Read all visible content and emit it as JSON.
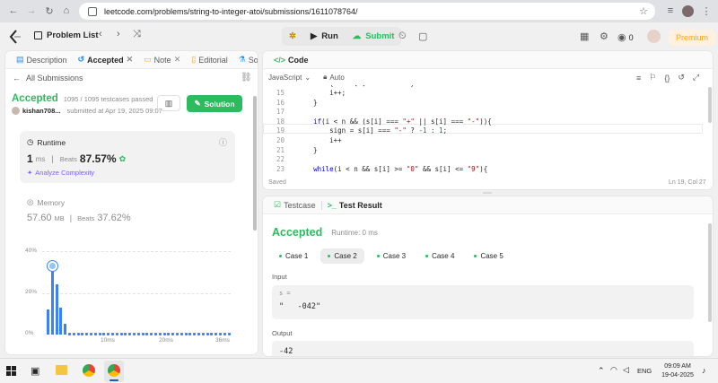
{
  "browser": {
    "url": "leetcode.com/problems/string-to-integer-atoi/submissions/1611078764/"
  },
  "nav": {
    "problem_list": "Problem List",
    "run": "Run",
    "submit": "Submit",
    "coins": "0",
    "premium": "Premium"
  },
  "left": {
    "tabs": [
      "Description",
      "Accepted",
      "Note",
      "Editorial",
      "Soluti"
    ],
    "all_submissions": "All Submissions",
    "status": "Accepted",
    "testcases": "1095 / 1095 testcases passed",
    "user": "kishan708...",
    "submitted": "submitted at Apr 19, 2025 09:07",
    "solution_btn": "Solution",
    "runtime_label": "Runtime",
    "runtime_value": "1",
    "runtime_unit": "ms",
    "beats_label": "Beats",
    "runtime_beats": "87.57%",
    "analyze": "Analyze Complexity",
    "memory_label": "Memory",
    "memory_value": "57.60",
    "memory_unit": "MB",
    "memory_beats": "37.62%"
  },
  "chart_data": {
    "type": "bar",
    "y_ticks": [
      "40%",
      "20%",
      "0%"
    ],
    "x_ticks": [
      "10ms",
      "20ms",
      "36ms"
    ],
    "ylim": [
      0,
      40
    ],
    "values": [
      12,
      34,
      24,
      13,
      5,
      1,
      1,
      1,
      1,
      1,
      1,
      1,
      1,
      1,
      1,
      1,
      1,
      1,
      1,
      1,
      1,
      1,
      1,
      1,
      1,
      1,
      1,
      1,
      1,
      1,
      1,
      1,
      1,
      1,
      1,
      1,
      1,
      1,
      1,
      1,
      1,
      1,
      1
    ],
    "highlight_index": 1,
    "color": "#3b82f6"
  },
  "code": {
    "title": "Code",
    "language": "JavaScript",
    "mode": "Auto",
    "status": "Saved",
    "cursor": "Ln 19, Col 27",
    "lines": [
      {
        "n": "15",
        "t": "        i++;"
      },
      {
        "n": "16",
        "t": "    }"
      },
      {
        "n": "17",
        "t": ""
      },
      {
        "n": "18",
        "t": "    if(i < n && (s[i] === \"+\" || s[i] === \"-\")){"
      },
      {
        "n": "19",
        "t": "        sign = s[i] === \"-\" ? -1 : 1;"
      },
      {
        "n": "20",
        "t": "        i++"
      },
      {
        "n": "21",
        "t": "    }"
      },
      {
        "n": "22",
        "t": ""
      },
      {
        "n": "23",
        "t": "    while(i < n && s[i] >= \"0\" && s[i] <= \"9\"){"
      }
    ]
  },
  "result": {
    "testcase_tab": "Testcase",
    "result_tab": "Test Result",
    "status": "Accepted",
    "runtime": "Runtime: 0 ms",
    "cases": [
      "Case 1",
      "Case 2",
      "Case 3",
      "Case 4",
      "Case 5"
    ],
    "input_label": "Input",
    "input_var": "s =",
    "input_value": "\"   -042\"",
    "output_label": "Output",
    "output_value": "-42"
  },
  "taskbar": {
    "lang": "ENG",
    "time": "09:09 AM",
    "date": "19-04-2025"
  }
}
